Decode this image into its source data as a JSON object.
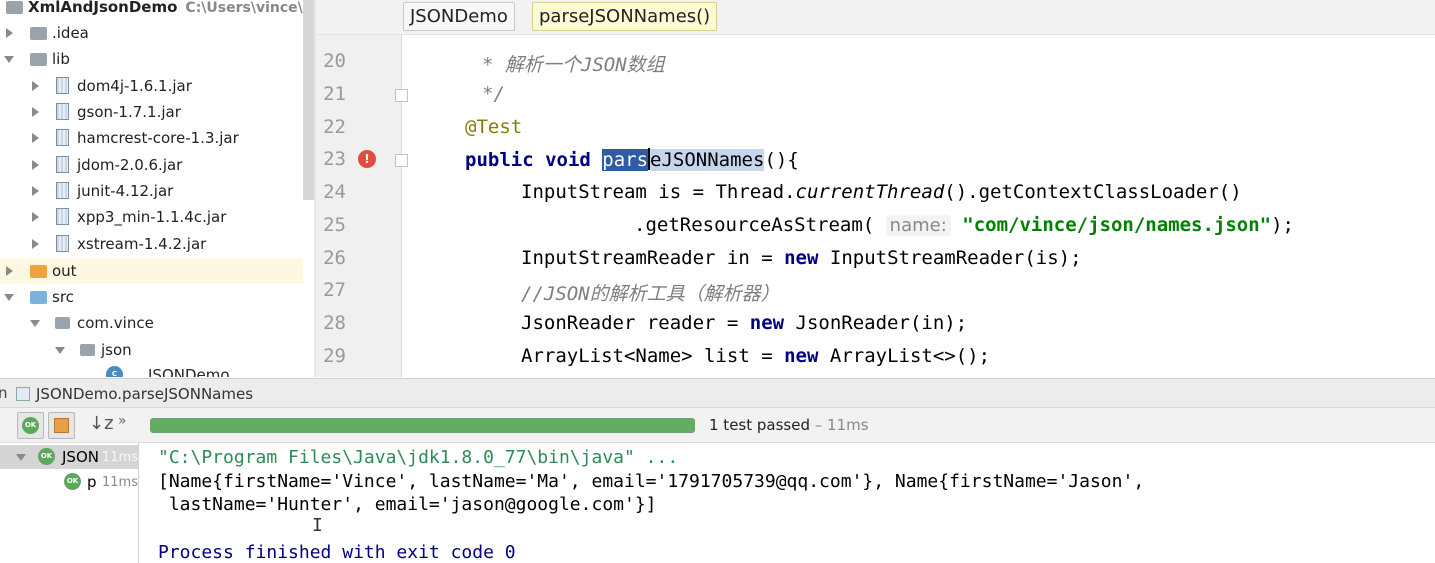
{
  "project": {
    "root_name": "XmlAndJsonDemo",
    "root_path": "C:\\Users\\vince\\Ide",
    "items": [
      {
        "label": ".idea"
      },
      {
        "label": "lib"
      },
      {
        "label": "dom4j-1.6.1.jar"
      },
      {
        "label": "gson-1.7.1.jar"
      },
      {
        "label": "hamcrest-core-1.3.jar"
      },
      {
        "label": "jdom-2.0.6.jar"
      },
      {
        "label": "junit-4.12.jar"
      },
      {
        "label": "xpp3_min-1.1.4c.jar"
      },
      {
        "label": "xstream-1.4.2.jar"
      },
      {
        "label": "out"
      },
      {
        "label": "src"
      },
      {
        "label": "com.vince"
      },
      {
        "label": "json"
      },
      {
        "label": "JSONDemo"
      }
    ]
  },
  "editor": {
    "breadcrumbs": [
      "JSONDemo",
      "parseJSONNames()"
    ],
    "line_numbers": [
      "20",
      "21",
      "22",
      "23",
      "24",
      "25",
      "26",
      "27",
      "28",
      "29"
    ],
    "lines": {
      "l20": "* 解析一个JSON数组",
      "l21": "*/",
      "l22": "@Test",
      "l23_kw": "public void ",
      "l23_sel": "pars",
      "l23_sel2": "eJSONNames",
      "l23_rest": "(){",
      "l24_a": "InputStream is = Thread.",
      "l24_b": "currentThread",
      "l24_c": "().getContextClassLoader()",
      "l25_a": ".getResourceAsStream(",
      "l25_hint": "name:",
      "l25_str": "\"com/vince/json/names.json\"",
      "l25_end": ");",
      "l26_a": "InputStreamReader in = ",
      "l26_kw": "new",
      "l26_b": " InputStreamReader(is);",
      "l27": "//JSON的解析工具（解析器）",
      "l28_a": "JsonReader reader = ",
      "l28_kw": "new",
      "l28_b": " JsonReader(in);",
      "l29_a": "ArrayList<Name> list = ",
      "l29_kw": "new",
      "l29_b": " ArrayList<>();"
    }
  },
  "run": {
    "tab_title": "JSONDemo.parseJSONNames",
    "status": "1 test passed",
    "duration": " – 11ms",
    "progress": 1.0,
    "tests": [
      {
        "badge": "OK",
        "name": "JSON",
        "time": "11ms"
      },
      {
        "badge": "OK",
        "name": "p",
        "time": "11ms"
      }
    ],
    "console": [
      "\"C:\\Program Files\\Java\\jdk1.8.0_77\\bin\\java\" ...",
      "[Name{firstName='Vince', lastName='Ma', email='1791705739@qq.com'}, Name{firstName='Jason',",
      " lastName='Hunter', email='jason@google.com'}]",
      "Process finished with exit code 0"
    ],
    "colors": {
      "console_cmd": "#2e8b57",
      "process_finished": "#000080",
      "progress": "#63ad63"
    }
  }
}
